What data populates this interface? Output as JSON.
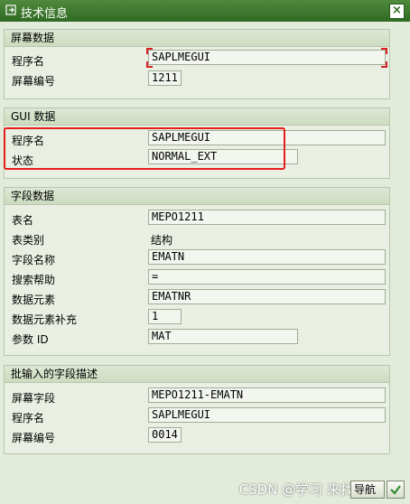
{
  "window": {
    "title": "技术信息",
    "close_glyph": "×"
  },
  "screen_data": {
    "title": "屏幕数据",
    "program_label": "程序名",
    "program_value": "SAPLMEGUI",
    "screen_no_label": "屏幕编号",
    "screen_no_value": "1211"
  },
  "gui_data": {
    "title": "GUI 数据",
    "program_label": "程序名",
    "program_value": "SAPLMEGUI",
    "status_label": "状态",
    "status_value": "NORMAL_EXT"
  },
  "field_data": {
    "title": "字段数据",
    "table_name_label": "表名",
    "table_name_value": "MEPO1211",
    "table_type_label": "表类别",
    "table_type_value": "结构",
    "field_name_label": "字段名称",
    "field_name_value": "EMATN",
    "search_help_label": "搜索帮助",
    "search_help_value": "=",
    "data_element_label": "数据元素",
    "data_element_value": "EMATNR",
    "data_element_supp_label": "数据元素补充",
    "data_element_supp_value": "1",
    "parameter_id_label": "参数 ID",
    "parameter_id_value": "MAT"
  },
  "batch_input": {
    "title": "批输入的字段描述",
    "screen_field_label": "屏幕字段",
    "screen_field_value": "MEPO1211-EMATN",
    "program_label": "程序名",
    "program_value": "SAPLMEGUI",
    "screen_no_label": "屏幕编号",
    "screen_no_value": "0014"
  },
  "footer": {
    "watermark": "CSDN @学习  来找我玩",
    "navigation_button": "导航",
    "confirm_icon": "check-icon"
  },
  "colors": {
    "titlebar": "#3a7a2c",
    "highlight": "#e81c1c"
  }
}
